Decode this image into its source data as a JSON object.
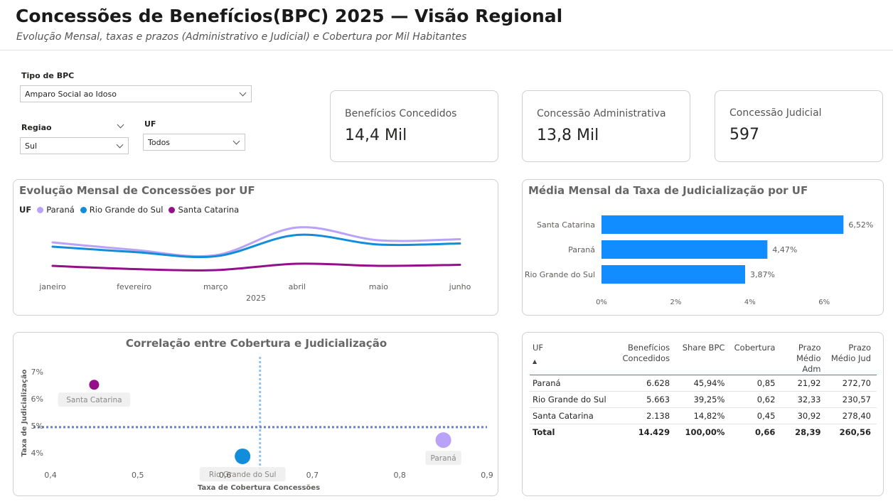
{
  "header": {
    "title": "Concessões de Benefícios(BPC) 2025 — Visão Regional",
    "subtitle": "Evolução Mensal, taxas e prazos (Administrativo e Judicial) e Cobertura por Mil Habitantes"
  },
  "filters": {
    "tipo_label": "Tipo de BPC",
    "tipo_value": "Amparo Social ao Idoso",
    "regiao_label": "Regiao",
    "regiao_value": "Sul",
    "uf_label": "UF",
    "uf_value": "Todos"
  },
  "kpis": [
    {
      "label": "Benefícios Concedidos",
      "value": "14,4 Mil"
    },
    {
      "label": "Concessão Administrativa",
      "value": "13,8 Mil"
    },
    {
      "label": "Concessão Judicial",
      "value": "597"
    }
  ],
  "colors": {
    "parana": "#B9A2F7",
    "rs": "#118DDB",
    "sc": "#950E8A",
    "bar": "#118DFF",
    "ref": "#6B7FC4"
  },
  "chart_data": [
    {
      "type": "line",
      "title": "Evolução Mensal de Concessões por UF",
      "legend_title": "UF",
      "xlabel": "2025",
      "categories": [
        "janeiro",
        "fevereiro",
        "março",
        "abril",
        "maio",
        "junho"
      ],
      "series": [
        {
          "name": "Paraná",
          "values": [
            1080,
            1010,
            960,
            1220,
            1100,
            1110
          ]
        },
        {
          "name": "Rio Grande do Sul",
          "values": [
            1040,
            990,
            950,
            1150,
            1060,
            1070
          ]
        },
        {
          "name": "Santa Catarina",
          "values": [
            860,
            830,
            820,
            880,
            860,
            870
          ]
        }
      ],
      "ylim": [
        700,
        1300
      ],
      "legend": "top-left"
    },
    {
      "type": "bar",
      "title": "Média Mensal da Taxa de Judicialização por UF",
      "categories": [
        "Santa Catarina",
        "Paraná",
        "Rio Grande do Sul"
      ],
      "values": [
        6.52,
        4.47,
        3.87
      ],
      "labels": [
        "6,52%",
        "4,47%",
        "3,87%"
      ],
      "xticks": [
        "0%",
        "2%",
        "4%",
        "6%"
      ],
      "xlim": [
        0,
        7.5
      ]
    },
    {
      "type": "scatter",
      "title": "Correlação entre Cobertura e Judicialização",
      "xlabel": "Taxa de Cobertura Concessões",
      "ylabel": "Taxa de Judicialização",
      "xlim": [
        0.4,
        0.9
      ],
      "ylim": [
        3.7,
        7.2
      ],
      "xticks": [
        "0,4",
        "0,5",
        "0,6",
        "0,7",
        "0,8",
        "0,9"
      ],
      "yticks": [
        "4%",
        "5%",
        "6%",
        "7%"
      ],
      "points": [
        {
          "name": "Santa Catarina",
          "x": 0.45,
          "y": 6.52
        },
        {
          "name": "Rio Grande do Sul",
          "x": 0.62,
          "y": 3.87
        },
        {
          "name": "Paraná",
          "x": 0.85,
          "y": 4.47
        }
      ],
      "reference_lines": {
        "x": 0.64,
        "y": 4.95
      }
    }
  ],
  "table": {
    "columns": [
      "UF",
      "Benefícios Concedidos",
      "Share BPC",
      "Cobertura",
      "Prazo Médio Adm",
      "Prazo Médio Jud"
    ],
    "rows": [
      [
        "Paraná",
        "6.628",
        "45,94%",
        "0,85",
        "21,92",
        "272,70"
      ],
      [
        "Rio Grande do Sul",
        "5.663",
        "39,25%",
        "0,62",
        "32,33",
        "230,57"
      ],
      [
        "Santa Catarina",
        "2.138",
        "14,82%",
        "0,45",
        "30,92",
        "278,40"
      ]
    ],
    "total": [
      "Total",
      "14.429",
      "100,00%",
      "0,66",
      "28,39",
      "260,56"
    ]
  }
}
